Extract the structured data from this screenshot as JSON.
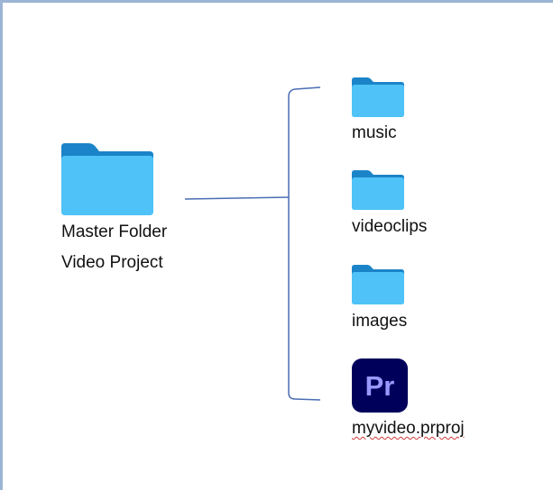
{
  "master": {
    "line1": "Master Folder",
    "line2": "Video Project",
    "icon": "folder-icon"
  },
  "children": [
    {
      "label": "music",
      "icon": "folder-icon"
    },
    {
      "label": "videoclips",
      "icon": "folder-icon"
    },
    {
      "label": "images",
      "icon": "folder-icon"
    },
    {
      "label": "myvideo.prproj",
      "icon": "premiere-pro-icon",
      "icon_text": "Pr"
    }
  ],
  "colors": {
    "folder_back": "#1b84c8",
    "folder_front": "#4fc3f7",
    "connector": "#4a6db4",
    "premiere_bg": "#00005b",
    "premiere_text": "#9999ff",
    "frame_border": "#9db4d6"
  }
}
